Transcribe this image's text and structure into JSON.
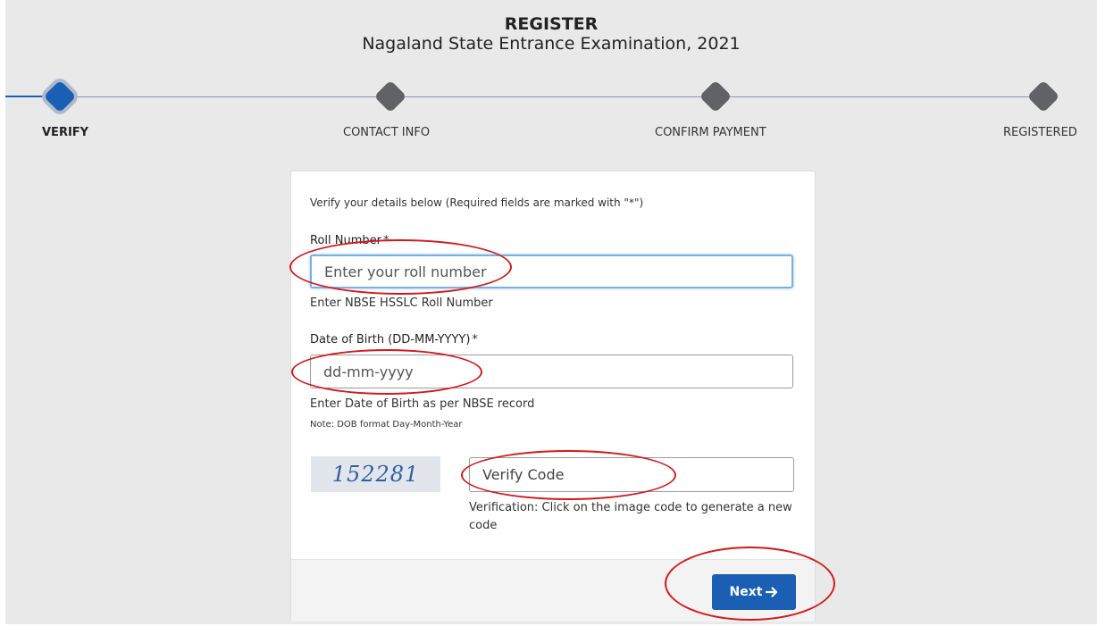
{
  "header": {
    "title": "REGISTER",
    "subtitle": "Nagaland State Entrance Examination, 2021"
  },
  "steps": [
    {
      "label": "VERIFY",
      "active": true
    },
    {
      "label": "CONTACT INFO",
      "active": false
    },
    {
      "label": "CONFIRM PAYMENT",
      "active": false
    },
    {
      "label": "REGISTERED",
      "active": false
    }
  ],
  "form": {
    "intro": "Verify your details below (Required fields are marked with \"*\")",
    "roll": {
      "label": "Roll Number",
      "required": "*",
      "placeholder": "Enter your roll number",
      "value": "",
      "help": "Enter NBSE HSSLC Roll Number"
    },
    "dob": {
      "label": "Date of Birth (DD-MM-YYYY)",
      "required": "*",
      "placeholder": "dd-mm-yyyy",
      "value": "",
      "help": "Enter Date of Birth as per NBSE record",
      "note": "Note: DOB format Day-Month-Year"
    },
    "captcha": {
      "code": "152281",
      "placeholder": "Verify Code",
      "value": "",
      "help": "Verification: Click on the image code to generate a new code"
    },
    "next_label": "Next",
    "next_icon": "arrow-right-icon"
  },
  "colors": {
    "accent": "#1a5fb4",
    "annotation": "#d4191c",
    "background": "#e9e9e9"
  }
}
